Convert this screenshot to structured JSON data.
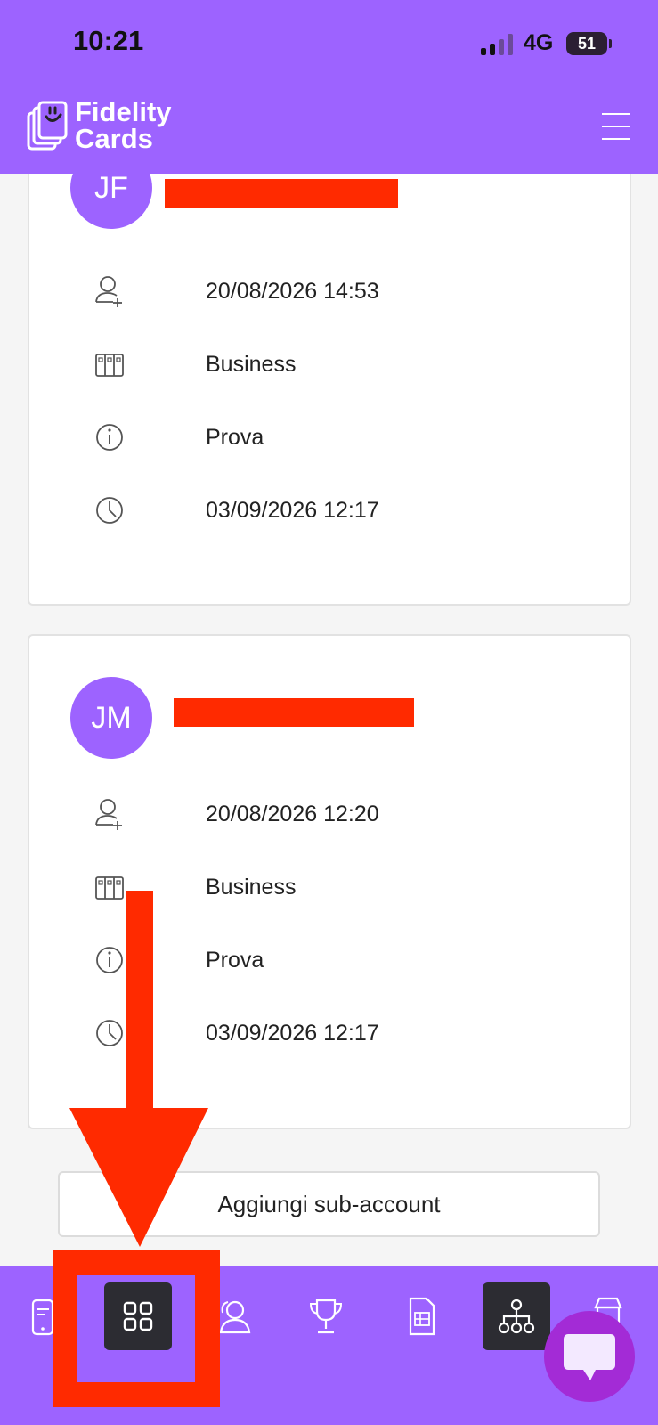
{
  "status_bar": {
    "time": "10:21",
    "network": "4G",
    "battery": "51"
  },
  "header": {
    "logo_line1": "Fidelity",
    "logo_line2": "Cards"
  },
  "cards": [
    {
      "initials": "JF",
      "created": "20/08/2026 14:53",
      "plan": "Business",
      "note": "Prova",
      "last_access": "03/09/2026 12:17"
    },
    {
      "initials": "JM",
      "created": "20/08/2026 12:20",
      "plan": "Business",
      "note": "Prova",
      "last_access": "03/09/2026 12:17"
    }
  ],
  "add_button": "Aggiungi sub-account",
  "tabbar": {
    "tabs": [
      {
        "icon": "phone-card-icon",
        "active": false
      },
      {
        "icon": "grid-icon",
        "active": true
      },
      {
        "icon": "users-icon",
        "active": false
      },
      {
        "icon": "trophy-icon",
        "active": false
      },
      {
        "icon": "sheet-icon",
        "active": false
      },
      {
        "icon": "hierarchy-icon",
        "active": true
      },
      {
        "icon": "store-icon",
        "active": false
      }
    ]
  },
  "colors": {
    "brand": "#9d63ff",
    "annotation": "#ff2a00",
    "chat": "#a32bd6",
    "active_tab": "#2c2c32"
  }
}
